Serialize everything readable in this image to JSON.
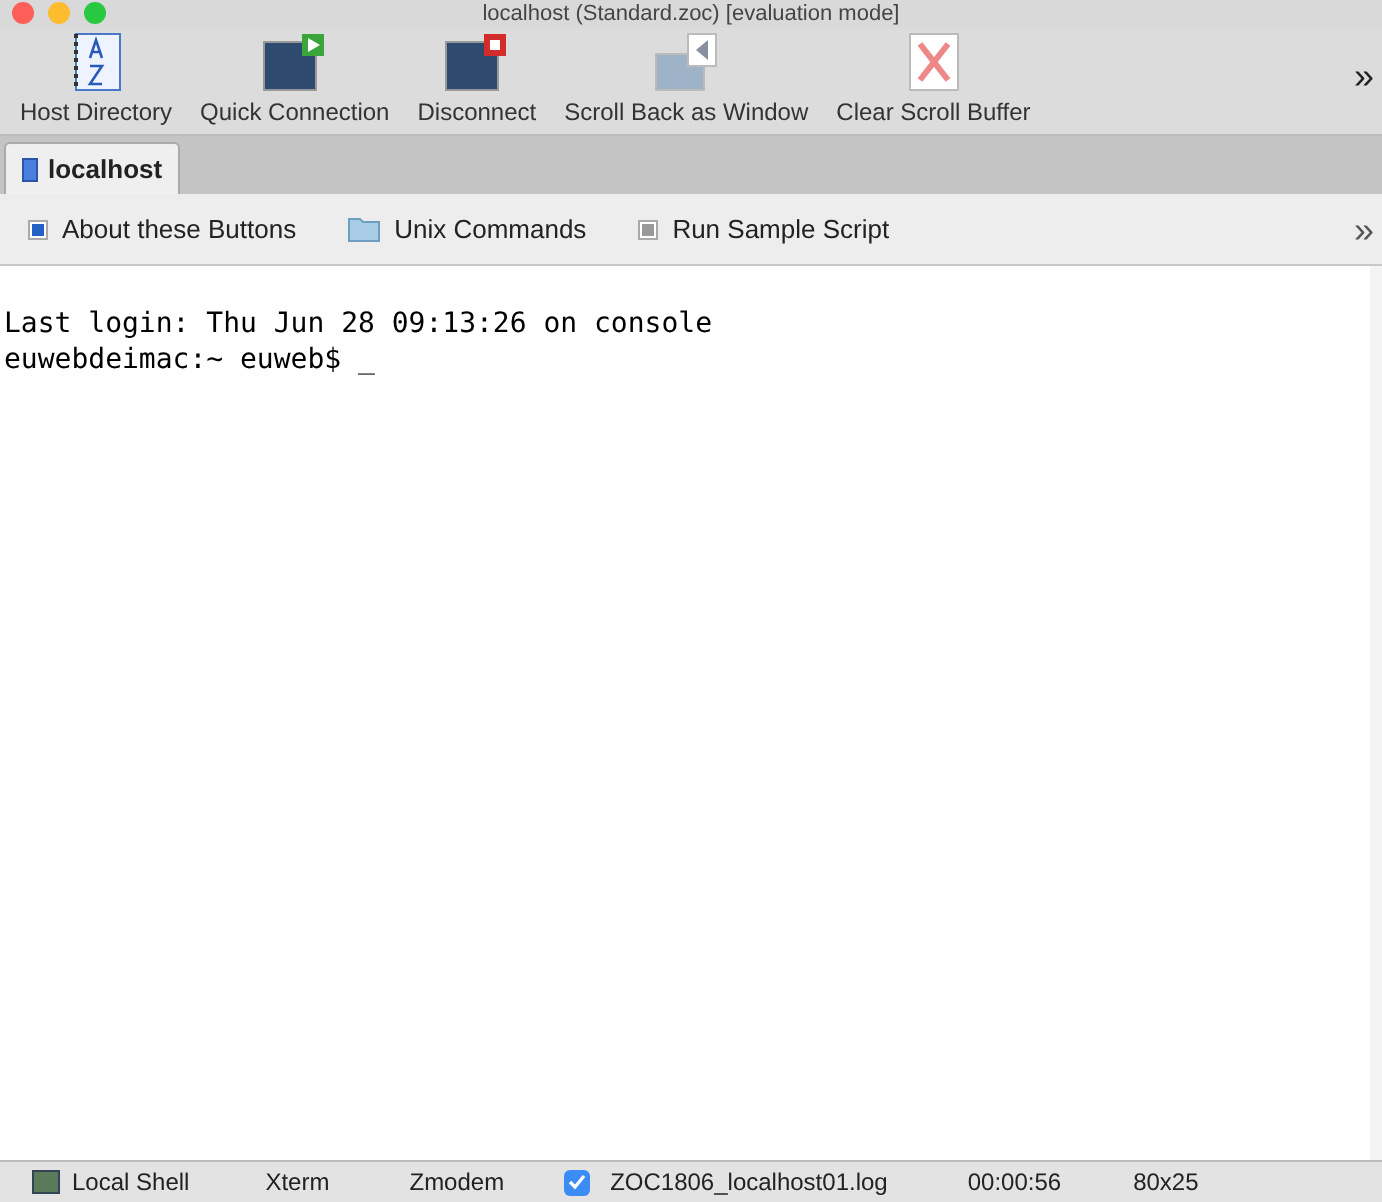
{
  "window": {
    "title": "localhost (Standard.zoc) [evaluation mode]"
  },
  "toolbar": [
    {
      "label": "Host Directory",
      "kind": "directory"
    },
    {
      "label": "Quick Connection",
      "kind": "connect"
    },
    {
      "label": "Disconnect",
      "kind": "disconnect"
    },
    {
      "label": "Scroll Back as Window",
      "kind": "scrollback"
    },
    {
      "label": "Clear Scroll Buffer",
      "kind": "clear"
    }
  ],
  "toolbar_overflow": "»",
  "tabs": [
    {
      "label": "localhost",
      "selected": true
    }
  ],
  "buttons": [
    {
      "label": "About these Buttons",
      "kind": "button"
    },
    {
      "label": "Unix Commands",
      "kind": "folder"
    },
    {
      "label": "Run Sample Script",
      "kind": "script"
    }
  ],
  "buttons_overflow": "»",
  "terminal": {
    "lines": [
      "Last login: Thu Jun 28 09:13:26 on console",
      "euwebdeimac:~ euweb$ _"
    ]
  },
  "status_bar": {
    "connection": "Local Shell",
    "emulation": "Xterm",
    "transfer": "Zmodem",
    "log_enabled": true,
    "log_file": "ZOC1806_localhost01.log",
    "elapsed": "00:00:56",
    "size": "80x25"
  }
}
